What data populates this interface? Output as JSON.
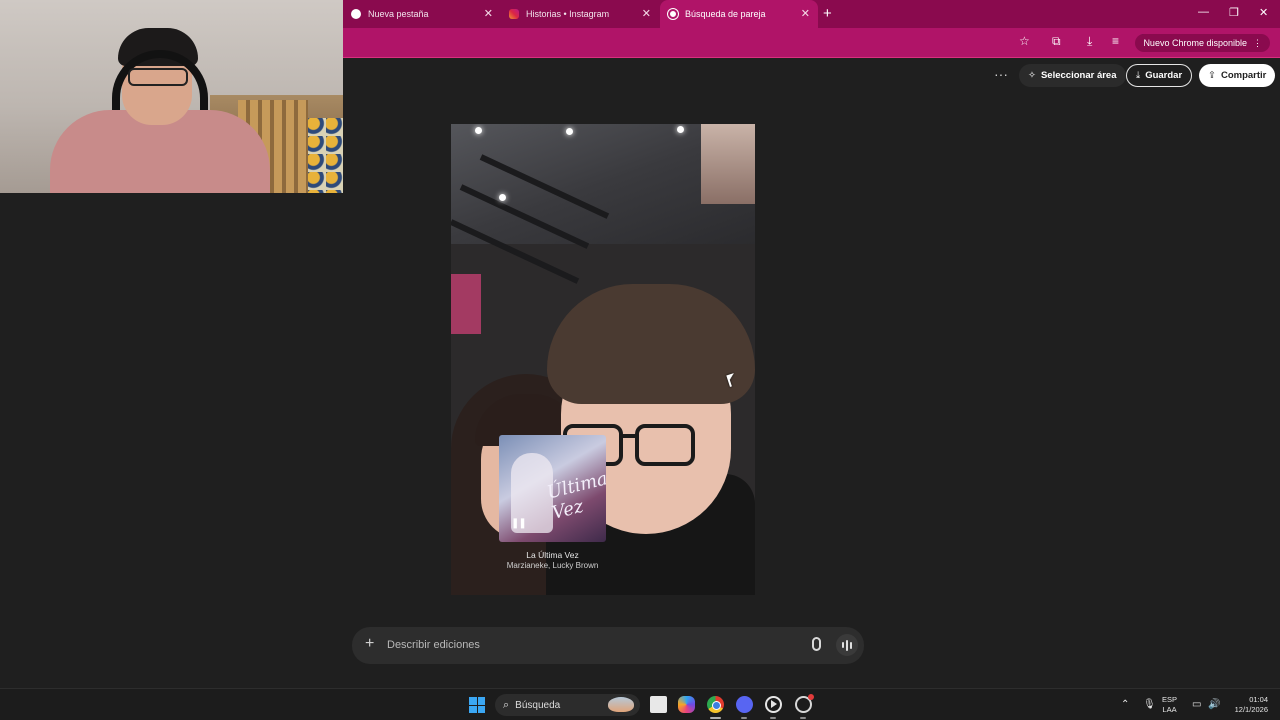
{
  "browser": {
    "tabs": [
      {
        "label": "Nueva pestaña",
        "icon": "chrome-icon",
        "active": false
      },
      {
        "label": "Historias • Instagram",
        "icon": "instagram-icon",
        "active": false
      },
      {
        "label": "Búsqueda de pareja",
        "icon": "threads-icon",
        "active": true
      }
    ],
    "update_label": "Nuevo Chrome disponible",
    "accent_color": "#b01468"
  },
  "actions": {
    "select_area": "Seleccionar área",
    "save": "Guardar",
    "share": "Compartir"
  },
  "media": {
    "song_title": "La Última Vez",
    "song_artist": "Marzianeke, Lucky Brown",
    "album_art_text": "Última Vez"
  },
  "prompt": {
    "placeholder": "Describir ediciones"
  },
  "taskbar": {
    "search_label": "Búsqueda",
    "lang_line1": "ESP",
    "lang_line2": "LAA",
    "time": "01:04",
    "date": "12/1/2026"
  }
}
